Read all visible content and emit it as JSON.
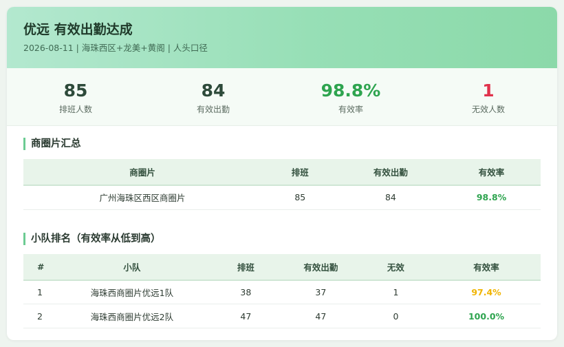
{
  "header": {
    "title": "优远 有效出勤达成",
    "subtitle": "2026-08-11 | 海珠西区+龙美+黄阁 | 人头口径"
  },
  "stats": [
    {
      "value": "85",
      "label": "排班人数",
      "color": "#2d4a3a"
    },
    {
      "value": "84",
      "label": "有效出勤",
      "color": "#2d4a3a"
    },
    {
      "value": "98.8%",
      "label": "有效率",
      "color": "#2ea44f"
    },
    {
      "value": "1",
      "label": "无效人数",
      "color": "#e0314b"
    }
  ],
  "area_summary": {
    "title": "商圈片汇总",
    "columns": [
      "商圈片",
      "排班",
      "有效出勤",
      "有效率"
    ],
    "rows": [
      {
        "name": "广州海珠区西区商圈片",
        "scheduled": "85",
        "effective": "84",
        "rate": "98.8%"
      }
    ]
  },
  "team_ranking": {
    "title": "小队排名（有效率从低到高）",
    "columns": [
      "#",
      "小队",
      "排班",
      "有效出勤",
      "无效",
      "有效率"
    ],
    "rows": [
      {
        "rank": "1",
        "team": "海珠西商圈片优远1队",
        "scheduled": "38",
        "effective": "37",
        "invalid": "1",
        "rate": "97.4%"
      },
      {
        "rank": "2",
        "team": "海珠西商圈片优远2队",
        "scheduled": "47",
        "effective": "47",
        "invalid": "0",
        "rate": "100.0%"
      }
    ]
  },
  "colors": {
    "good": "#2ea44f",
    "warn": "#f0b400",
    "bad": "#e0314b"
  }
}
